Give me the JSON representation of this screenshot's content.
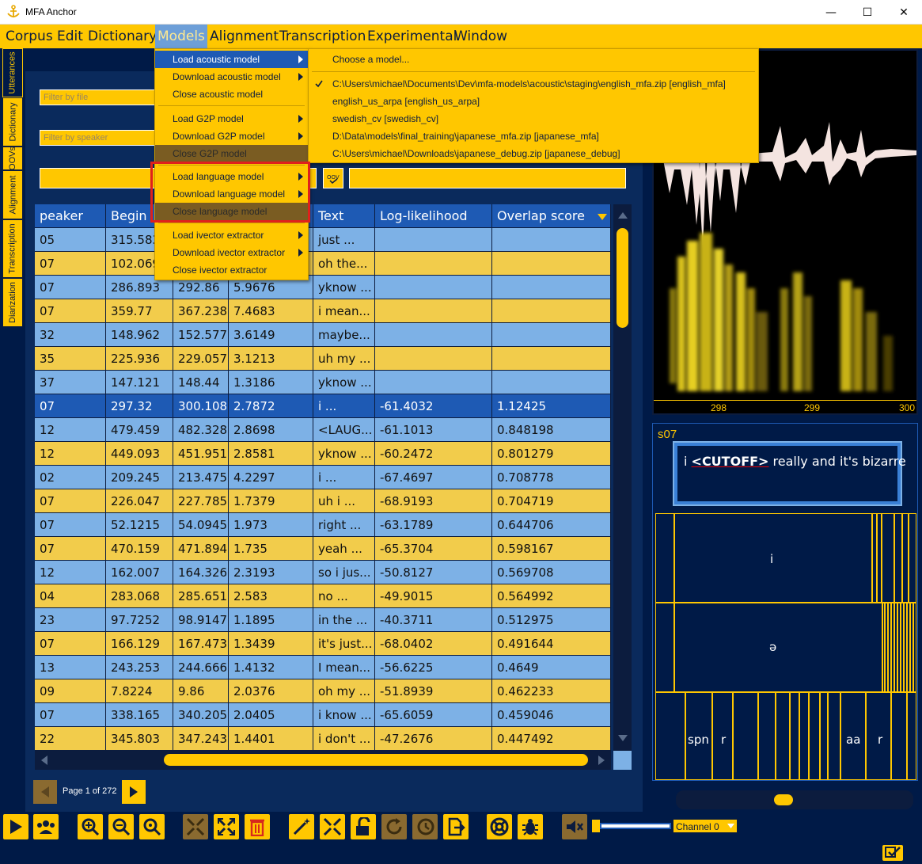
{
  "window": {
    "title": "MFA Anchor",
    "minimize": "—",
    "maximize": "☐",
    "close": "✕"
  },
  "menubar": [
    "Corpus",
    "Edit",
    "Dictionary",
    "Models",
    "Alignment",
    "Transcription",
    "Experimental",
    "Window"
  ],
  "left_tabs": [
    "Utterances",
    "Dictionary",
    "OOVs",
    "Alignment",
    "Transcription",
    "Diarization"
  ],
  "filters": {
    "file_placeholder": "Filter by file",
    "speaker_placeholder": "Filter by speaker"
  },
  "models_menu": [
    {
      "label": "Load acoustic model",
      "submenu": true,
      "state": "highlighted"
    },
    {
      "label": "Download acoustic model",
      "submenu": true,
      "state": "normal"
    },
    {
      "label": "Close acoustic model",
      "submenu": false,
      "state": "normal"
    },
    {
      "label": "Load G2P model",
      "submenu": true,
      "state": "normal"
    },
    {
      "label": "Download G2P model",
      "submenu": true,
      "state": "normal"
    },
    {
      "label": "Close G2P model",
      "submenu": false,
      "state": "disabled"
    },
    {
      "label": "Load language model",
      "submenu": true,
      "state": "normal"
    },
    {
      "label": "Download language model",
      "submenu": true,
      "state": "normal"
    },
    {
      "label": "Close language model",
      "submenu": false,
      "state": "disabled"
    },
    {
      "label": "Load ivector extractor",
      "submenu": true,
      "state": "normal"
    },
    {
      "label": "Download ivector extractor",
      "submenu": true,
      "state": "normal"
    },
    {
      "label": "Close ivector extractor",
      "submenu": false,
      "state": "normal"
    }
  ],
  "acoustic_submenu": {
    "choose": "Choose a model...",
    "items": [
      {
        "label": "C:\\Users\\michael\\Documents\\Dev\\mfa-models\\acoustic\\staging\\english_mfa.zip [english_mfa]",
        "checked": true
      },
      {
        "label": "english_us_arpa [english_us_arpa]",
        "checked": false
      },
      {
        "label": "swedish_cv [swedish_cv]",
        "checked": false
      },
      {
        "label": "D:\\Data\\models\\final_training\\japanese_mfa.zip [japanese_mfa]",
        "checked": false
      },
      {
        "label": "C:\\Users\\michael\\Downloads\\japanese_debug.zip [japanese_debug]",
        "checked": false
      }
    ]
  },
  "table": {
    "headers": [
      "peaker",
      "Begin",
      "",
      "",
      "Text",
      "Log-likelihood",
      "Overlap score"
    ],
    "rows": [
      [
        "05",
        "315.583",
        "",
        "",
        "just ...",
        "",
        ""
      ],
      [
        "07",
        "102.069",
        "",
        "",
        "oh the...",
        "",
        ""
      ],
      [
        "07",
        "286.893",
        "292.86",
        "5.9676",
        "yknow ...",
        "",
        ""
      ],
      [
        "07",
        "359.77",
        "367.238",
        "7.4683",
        "i mean...",
        "",
        ""
      ],
      [
        "32",
        "148.962",
        "152.577",
        "3.6149",
        "maybe...",
        "",
        ""
      ],
      [
        "35",
        "225.936",
        "229.057",
        "3.1213",
        "uh my ...",
        "",
        ""
      ],
      [
        "37",
        "147.121",
        "148.44",
        "1.3186",
        "yknow ...",
        "",
        ""
      ],
      [
        "07",
        "297.32",
        "300.108",
        "2.7872",
        "i ...",
        "-61.4032",
        "1.12425"
      ],
      [
        "12",
        "479.459",
        "482.328",
        "2.8698",
        "<LAUG...",
        "-61.1013",
        "0.848198"
      ],
      [
        "12",
        "449.093",
        "451.951",
        "2.8581",
        "yknow ...",
        "-60.2472",
        "0.801279"
      ],
      [
        "02",
        "209.245",
        "213.475",
        "4.2297",
        "i ...",
        "-67.4697",
        "0.708778"
      ],
      [
        "07",
        "226.047",
        "227.785",
        "1.7379",
        "uh i ...",
        "-68.9193",
        "0.704719"
      ],
      [
        "07",
        "52.1215",
        "54.0945",
        "1.973",
        "right ...",
        "-63.1789",
        "0.644706"
      ],
      [
        "07",
        "470.159",
        "471.894",
        "1.735",
        "yeah ...",
        "-65.3704",
        "0.598167"
      ],
      [
        "12",
        "162.007",
        "164.326",
        "2.3193",
        "so i jus...",
        "-50.8127",
        "0.569708"
      ],
      [
        "04",
        "283.068",
        "285.651",
        "2.583",
        "no ...",
        "-49.9015",
        "0.564992"
      ],
      [
        "23",
        "97.7252",
        "98.9147",
        "1.1895",
        "in the ...",
        "-40.3711",
        "0.512975"
      ],
      [
        "07",
        "166.129",
        "167.473",
        "1.3439",
        "it's just...",
        "-68.0402",
        "0.491644"
      ],
      [
        "13",
        "243.253",
        "244.666",
        "1.4132",
        "I mean...",
        "-56.6225",
        "0.4649"
      ],
      [
        "09",
        "7.8224",
        "9.86",
        "2.0376",
        "oh my ...",
        "-51.8939",
        "0.462233"
      ],
      [
        "07",
        "338.165",
        "340.205",
        "2.0405",
        "i know ...",
        "-65.6059",
        "0.459046"
      ],
      [
        "22",
        "345.803",
        "347.243",
        "1.4401",
        "i don't ...",
        "-47.2676",
        "0.447492"
      ]
    ],
    "selected_row": 7
  },
  "pager": {
    "label": "Page 1 of 272"
  },
  "waveform": {
    "axis_labels": [
      "298",
      "299",
      "300"
    ]
  },
  "detail": {
    "speaker": "s07",
    "utterance_prefix": "i ",
    "utterance_tag": "<CUTOFF>",
    "utterance_suffix": " really and it's bizarre",
    "word_tier_label": "i",
    "phone_tier_label": "ə",
    "tier3_labels": [
      "spn",
      "r",
      "aa",
      "r"
    ]
  },
  "toolbar": {
    "channel": "Channel 0"
  },
  "colors": {
    "accent": "#ffc700",
    "background": "#001a47",
    "row_blue": "#7db1e6",
    "row_gold": "#f2cc4b",
    "selection": "#1e5ab4",
    "highlight_box": "#e0201c"
  }
}
